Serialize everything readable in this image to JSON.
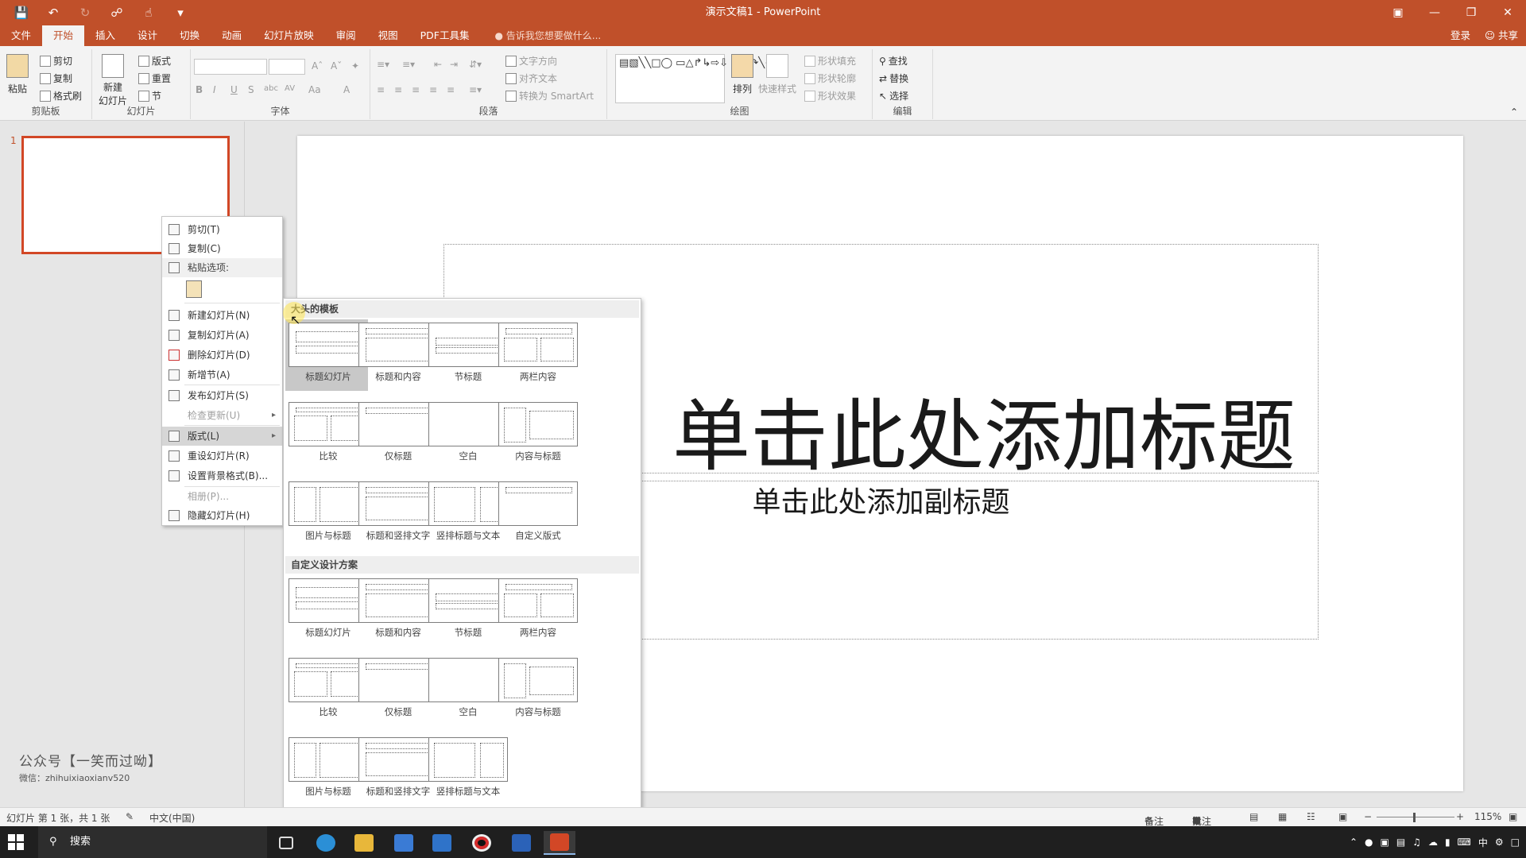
{
  "window": {
    "title": "演示文稿1  -  PowerPoint"
  },
  "qat": {
    "icons": [
      "save-icon",
      "undo-icon",
      "redo-icon",
      "present-from-start-icon",
      "touch-mode-icon",
      "customize-qat-icon"
    ]
  },
  "tabs": [
    "文件",
    "开始",
    "插入",
    "设计",
    "切换",
    "动画",
    "幻灯片放映",
    "审阅",
    "视图",
    "PDF工具集"
  ],
  "tell_me": "告诉我您想要做什么...",
  "account": {
    "signin": "登录",
    "share": "共享"
  },
  "ribbon": {
    "clipboard": {
      "label": "剪贴板",
      "paste": "粘贴",
      "cut": "剪切",
      "copy": "复制",
      "format_painter": "格式刷"
    },
    "slides": {
      "label": "幻灯片",
      "new_slide": "新建",
      "new_slide2": "幻灯片",
      "layout": "版式",
      "reset": "重置",
      "section": "节"
    },
    "font": {
      "label": "字体",
      "bold": "B",
      "italic": "I",
      "underline": "U",
      "shadow": "S",
      "strike": "abc",
      "spacing": "AV",
      "case": "Aa",
      "color": "A"
    },
    "paragraph": {
      "label": "段落",
      "text_direction": "文字方向",
      "align_text": "对齐文本",
      "smartart": "转换为 SmartArt"
    },
    "drawing": {
      "label": "绘图",
      "arrange": "排列",
      "quick_styles": "快速样式",
      "fill": "形状填充",
      "outline": "形状轮廓",
      "effects": "形状效果"
    },
    "editing": {
      "label": "编辑",
      "find": "查找",
      "replace": "替换",
      "select": "选择"
    }
  },
  "slides_pane": {
    "slide_number": "1"
  },
  "slide": {
    "title_placeholder": "单击此处添加标题",
    "subtitle_placeholder": "单击此处添加副标题"
  },
  "context_menu": {
    "cut": "剪切(T)",
    "copy": "复制(C)",
    "paste_options": "粘贴选项:",
    "new_slide": "新建幻灯片(N)",
    "duplicate_slide": "复制幻灯片(A)",
    "delete_slide": "删除幻灯片(D)",
    "add_section": "新增节(A)",
    "publish_slides": "发布幻灯片(S)",
    "check_updates": "检查更新(U)",
    "layout": "版式(L)",
    "reset_slide": "重设幻灯片(R)",
    "format_background": "设置背景格式(B)...",
    "photo_album": "相册(P)...",
    "hide_slide": "隐藏幻灯片(H)"
  },
  "layout_gallery": {
    "section1": "大头的模板",
    "section2": "自定义设计方案",
    "items1": [
      "标题幻灯片",
      "标题和内容",
      "节标题",
      "两栏内容",
      "比较",
      "仅标题",
      "空白",
      "内容与标题",
      "图片与标题",
      "标题和竖排文字",
      "竖排标题与文本",
      "自定义版式"
    ],
    "items2": [
      "标题幻灯片",
      "标题和内容",
      "节标题",
      "两栏内容",
      "比较",
      "仅标题",
      "空白",
      "内容与标题",
      "图片与标题",
      "标题和竖排文字",
      "竖排标题与文本"
    ]
  },
  "watermark": {
    "line1": "公众号【一笑而过呦】",
    "line2": "微信：zhihuixiaoxianv520"
  },
  "statusbar": {
    "slide_info": "幻灯片 第 1 张，共 1 张",
    "language": "中文(中国)",
    "notes": "备注",
    "comments": "批注",
    "zoom": "115%"
  },
  "taskbar": {
    "search": "搜索",
    "tray_ime": "中"
  },
  "colors": {
    "accent": "#c0502a",
    "thumb_border": "#d24726"
  }
}
